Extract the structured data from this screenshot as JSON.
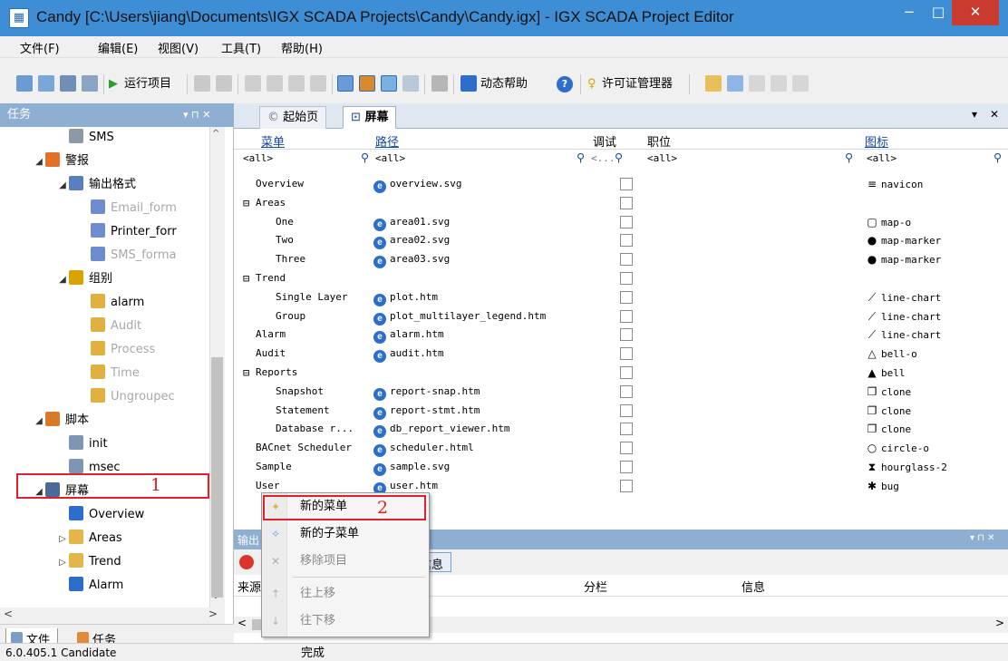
{
  "window": {
    "title": "Candy [C:\\Users\\jiang\\Documents\\IGX SCADA Projects\\Candy\\Candy.igx] - IGX SCADA Project Editor",
    "icon_glyph": "▦",
    "min_glyph": "−",
    "max_glyph": "□",
    "close_glyph": "✕"
  },
  "menu": [
    "文件(F)",
    "编辑(E)",
    "视图(V)",
    "工具(T)",
    "帮助(H)"
  ],
  "toolbar": {
    "run_project": "运行项目",
    "dynamic_help": "动态帮助",
    "license_manager": "许可证管理器",
    "run_glyph": "▶",
    "help_glyph": "?",
    "license_glyph": "♀"
  },
  "left_panel": {
    "title": "任务",
    "controls": "▾ ⊓ ✕",
    "tree": [
      {
        "label": "SMS",
        "icon": "phone-icon",
        "disabled": false
      },
      {
        "label": "警报",
        "icon": "alarm-icon",
        "disabled": false,
        "toggle": "◢"
      },
      {
        "label": "输出格式",
        "icon": "format-icon",
        "disabled": false,
        "toggle": "◢"
      },
      {
        "label": "Email_form",
        "icon": "template-icon",
        "disabled": true
      },
      {
        "label": "Printer_forr",
        "icon": "template-icon",
        "disabled": false
      },
      {
        "label": "SMS_forma",
        "icon": "template-icon",
        "disabled": true
      },
      {
        "label": "组别",
        "icon": "bell-group-icon",
        "disabled": false,
        "toggle": "◢"
      },
      {
        "label": "alarm",
        "icon": "bell-icon",
        "disabled": false
      },
      {
        "label": "Audit",
        "icon": "bell-icon",
        "disabled": true
      },
      {
        "label": "Process",
        "icon": "bell-icon",
        "disabled": true
      },
      {
        "label": "Time",
        "icon": "bell-icon",
        "disabled": true
      },
      {
        "label": "Ungroupec",
        "icon": "bell-icon",
        "disabled": true
      },
      {
        "label": "脚本",
        "icon": "script-icon",
        "disabled": false,
        "toggle": "◢"
      },
      {
        "label": "init",
        "icon": "script-file-icon",
        "disabled": false
      },
      {
        "label": "msec",
        "icon": "script-file-icon",
        "disabled": false
      },
      {
        "label": "屏幕",
        "icon": "screen-icon",
        "disabled": false,
        "toggle": "◢"
      },
      {
        "label": "Overview",
        "icon": "ie-icon",
        "disabled": false
      },
      {
        "label": "Areas",
        "icon": "folder-icon",
        "disabled": false,
        "toggle": "▷"
      },
      {
        "label": "Trend",
        "icon": "folder-icon",
        "disabled": false,
        "toggle": "▷"
      },
      {
        "label": "Alarm",
        "icon": "ie-icon",
        "disabled": false
      }
    ],
    "bottom_tabs": [
      "文件",
      "任务"
    ],
    "scroll_left": "<",
    "scroll_right": ">",
    "scroll_up": "^",
    "scroll_down": "v"
  },
  "document_tabs": {
    "start_page": "起始页",
    "screen": "屏幕",
    "dropdown_glyph": "▾",
    "close_glyph": "✕"
  },
  "grid": {
    "columns": [
      "菜单",
      "路径",
      "调试",
      "职位",
      "图标"
    ],
    "filters": [
      "<all>",
      "<all>",
      "<...",
      "<all>",
      "<all>"
    ],
    "rows": [
      {
        "menu": "Overview",
        "indent": 0,
        "toggle": "",
        "path": "overview.svg",
        "icon_glyph": "≡",
        "icon": "navicon"
      },
      {
        "menu": "Areas",
        "indent": 0,
        "toggle": "⊟",
        "path": "",
        "icon_glyph": "",
        "icon": ""
      },
      {
        "menu": "One",
        "indent": 1,
        "toggle": "",
        "path": "area01.svg",
        "icon_glyph": "▢",
        "icon": "map-o"
      },
      {
        "menu": "Two",
        "indent": 1,
        "toggle": "",
        "path": "area02.svg",
        "icon_glyph": "●",
        "icon": "map-marker"
      },
      {
        "menu": "Three",
        "indent": 1,
        "toggle": "",
        "path": "area03.svg",
        "icon_glyph": "●",
        "icon": "map-marker"
      },
      {
        "menu": "Trend",
        "indent": 0,
        "toggle": "⊟",
        "path": "",
        "icon_glyph": "",
        "icon": ""
      },
      {
        "menu": "Single Layer",
        "indent": 1,
        "toggle": "",
        "path": "plot.htm",
        "icon_glyph": "⟋",
        "icon": "line-chart"
      },
      {
        "menu": "Group",
        "indent": 1,
        "toggle": "",
        "path": "plot_multilayer_legend.htm",
        "icon_glyph": "⟋",
        "icon": "line-chart"
      },
      {
        "menu": "Alarm",
        "indent": 0,
        "toggle": "",
        "path": "alarm.htm",
        "icon_glyph": "⟋",
        "icon": "line-chart"
      },
      {
        "menu": "Audit",
        "indent": 0,
        "toggle": "",
        "path": "audit.htm",
        "icon_glyph": "△",
        "icon": "bell-o"
      },
      {
        "menu": "Reports",
        "indent": 0,
        "toggle": "⊟",
        "path": "",
        "icon_glyph": "▲",
        "icon": "bell"
      },
      {
        "menu": "Snapshot",
        "indent": 1,
        "toggle": "",
        "path": "report-snap.htm",
        "icon_glyph": "❐",
        "icon": "clone"
      },
      {
        "menu": "Statement",
        "indent": 1,
        "toggle": "",
        "path": "report-stmt.htm",
        "icon_glyph": "❐",
        "icon": "clone"
      },
      {
        "menu": "Database r...",
        "indent": 1,
        "toggle": "",
        "path": "db_report_viewer.htm",
        "icon_glyph": "❐",
        "icon": "clone"
      },
      {
        "menu": "BACnet Scheduler",
        "indent": 0,
        "toggle": "",
        "path": "scheduler.html",
        "icon_glyph": "○",
        "icon": "circle-o"
      },
      {
        "menu": "Sample",
        "indent": 0,
        "toggle": "",
        "path": "sample.svg",
        "icon_glyph": "⧗",
        "icon": "hourglass-2"
      },
      {
        "menu": "User",
        "indent": 0,
        "toggle": "",
        "path": "user.htm",
        "icon_glyph": "✱",
        "icon": "bug"
      },
      {
        "menu": "",
        "indent": 0,
        "toggle": "",
        "path": "",
        "icon_glyph": "▲",
        "icon": "user",
        "hidden_row": true
      }
    ]
  },
  "output_panel": {
    "title": "输出",
    "info_button": "信息",
    "columns": [
      "来源",
      "分栏",
      "信息"
    ]
  },
  "context_menu": {
    "items": [
      {
        "label": "新的菜单",
        "glyph": "✦",
        "disabled": false
      },
      {
        "label": "新的子菜单",
        "glyph": "✧",
        "disabled": false
      },
      {
        "label": "移除项目",
        "glyph": "✕",
        "disabled": true
      },
      {
        "label": "往上移",
        "glyph": "↑",
        "disabled": true
      },
      {
        "label": "往下移",
        "glyph": "↓",
        "disabled": true
      }
    ]
  },
  "annotations": {
    "n1": "1",
    "n2": "2"
  },
  "status": {
    "version": "6.0.405.1 Candidate",
    "message": "完成"
  },
  "colors": {
    "title_bar": "#3e8ed6",
    "panel_header": "#8eaed2",
    "highlight": "#e0202a",
    "link": "#1547a5"
  }
}
